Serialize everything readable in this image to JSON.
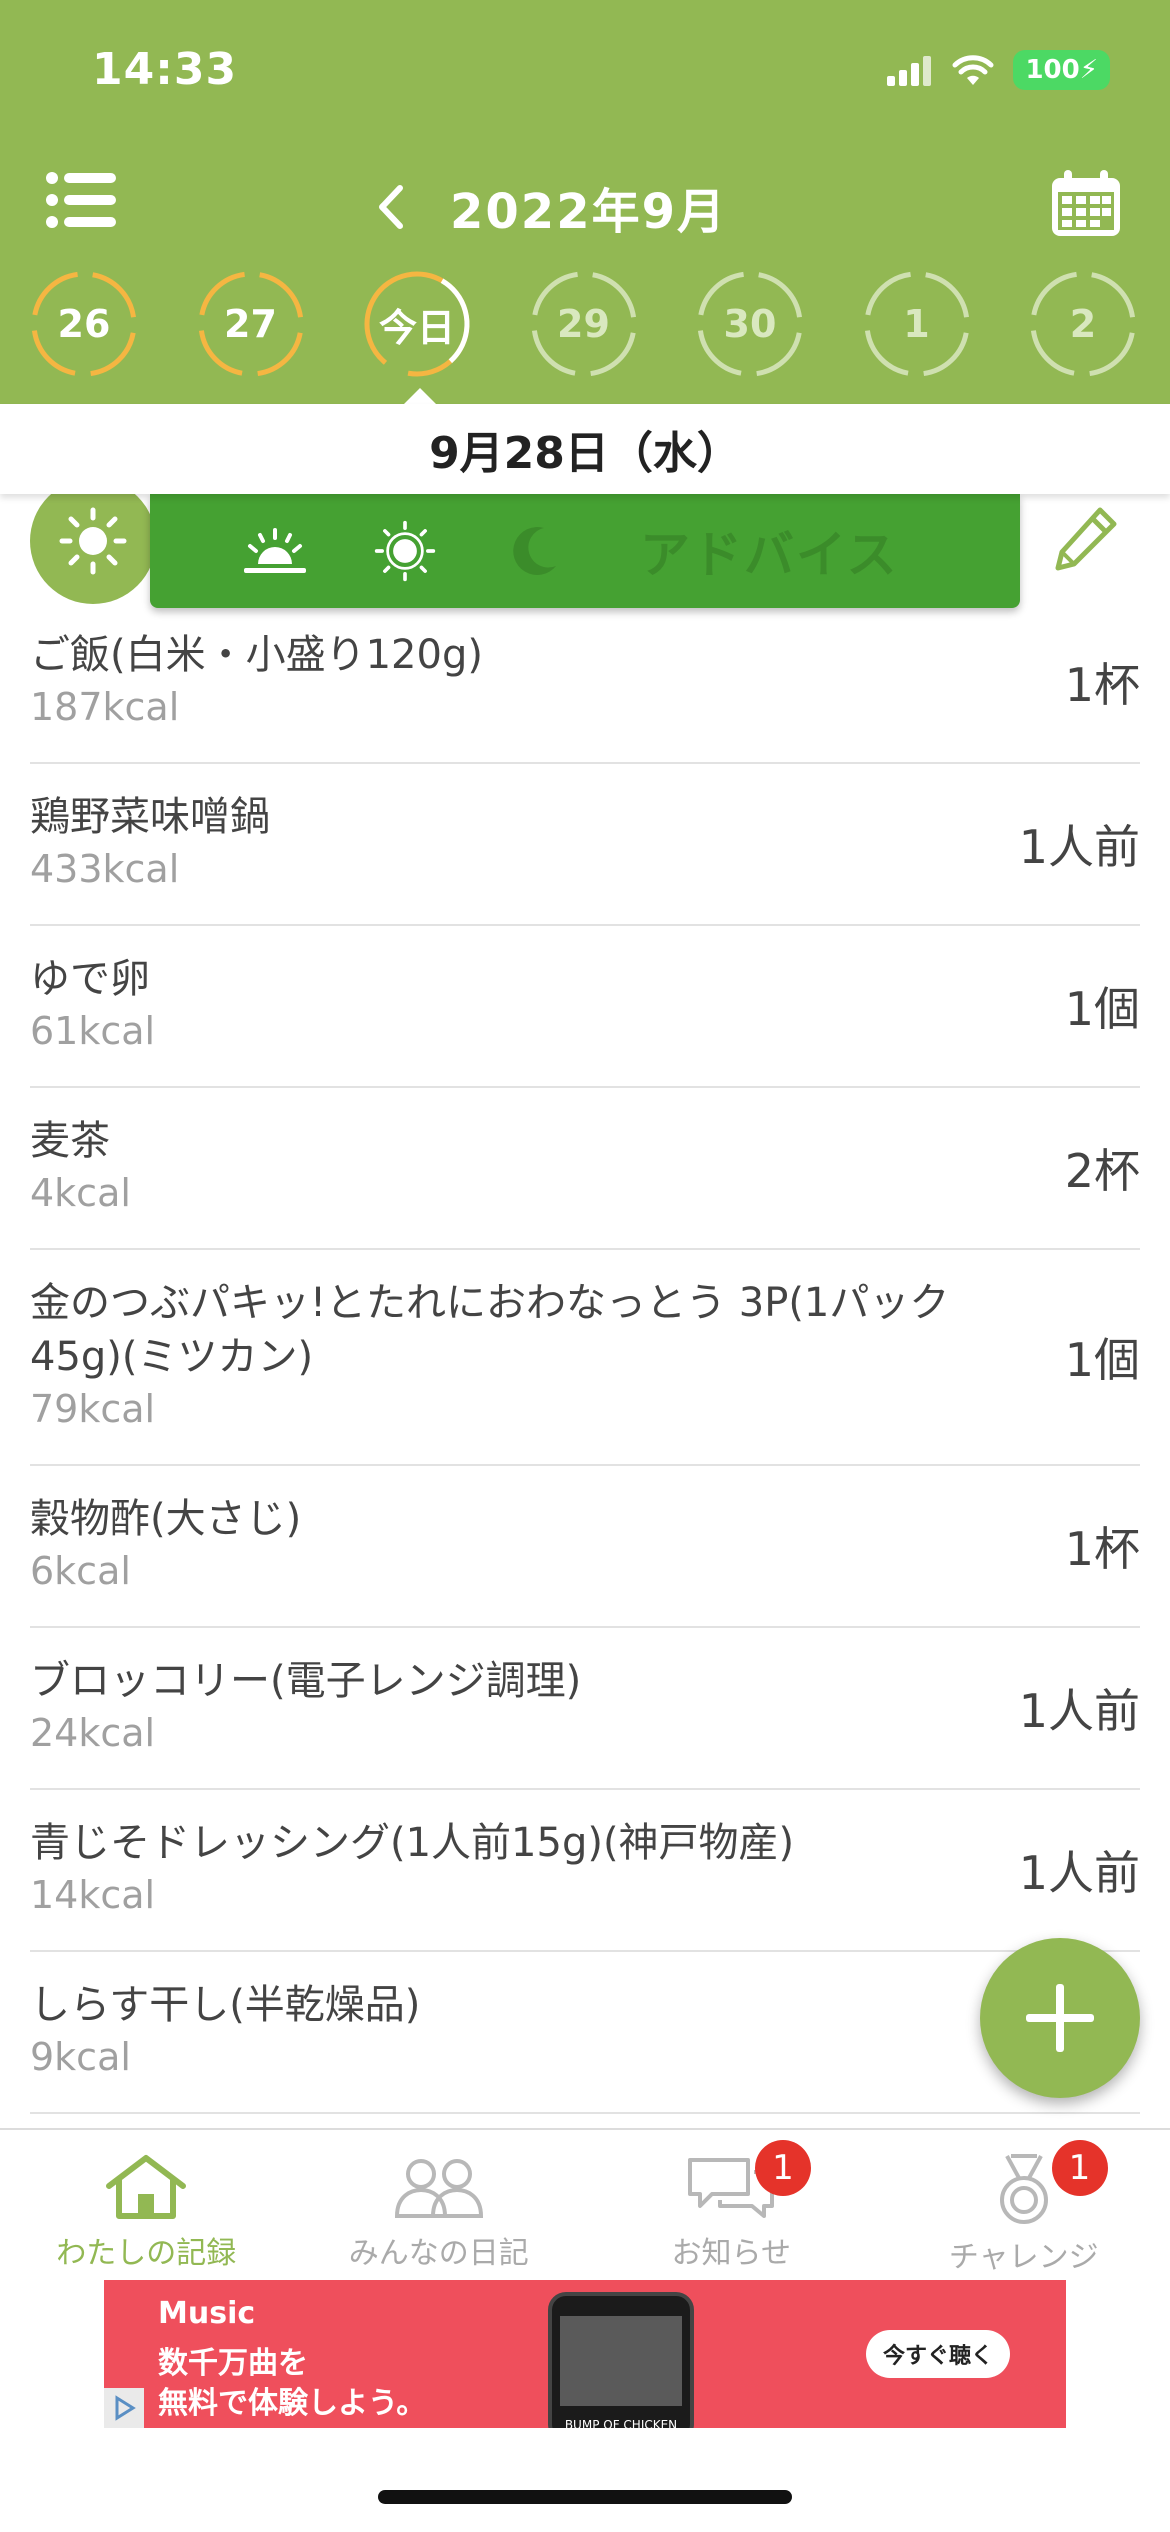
{
  "status_bar": {
    "time": "14:33",
    "battery": "100"
  },
  "header": {
    "month_title": "2022年9月",
    "days": [
      {
        "label": "26",
        "state": "past",
        "ring_color": "#f5b642"
      },
      {
        "label": "27",
        "state": "past",
        "ring_color": "#f5b642"
      },
      {
        "label": "今日",
        "state": "today",
        "ring_color": "#f5b642"
      },
      {
        "label": "29",
        "state": "future",
        "ring_color": "#cfe0b0"
      },
      {
        "label": "30",
        "state": "future",
        "ring_color": "#cfe0b0"
      },
      {
        "label": "1",
        "state": "future",
        "ring_color": "#cfe0b0"
      },
      {
        "label": "2",
        "state": "future",
        "ring_color": "#cfe0b0"
      }
    ]
  },
  "date_bar": {
    "label": "9月28日（水）"
  },
  "meal_tabs": {
    "icons": [
      "sunrise-icon",
      "sun-icon",
      "moon-icon"
    ],
    "advice_label": "アドバイス"
  },
  "foods": [
    {
      "name": "ご飯(白米・小盛り120g)",
      "kcal": "187kcal",
      "qty": "1杯"
    },
    {
      "name": "鶏野菜味噌鍋",
      "kcal": "433kcal",
      "qty": "1人前"
    },
    {
      "name": "ゆで卵",
      "kcal": "61kcal",
      "qty": "1個"
    },
    {
      "name": "麦茶",
      "kcal": "4kcal",
      "qty": "2杯"
    },
    {
      "name": "金のつぶパキッ!とたれにおわなっとう 3P(1パック45g)(ミツカン)",
      "kcal": "79kcal",
      "qty": "1個"
    },
    {
      "name": "穀物酢(大さじ)",
      "kcal": "6kcal",
      "qty": "1杯"
    },
    {
      "name": "ブロッコリー(電子レンジ調理)",
      "kcal": "24kcal",
      "qty": "1人前"
    },
    {
      "name": "青じそドレッシング(1人前15g)(神戸物産)",
      "kcal": "14kcal",
      "qty": "1人前"
    },
    {
      "name": "しらす干し(半乾燥品)",
      "kcal": "9kcal",
      "qty": ""
    }
  ],
  "bottom_nav": [
    {
      "label": "わたしの記録",
      "icon": "home-icon",
      "badge": ""
    },
    {
      "label": "みんなの日記",
      "icon": "people-icon",
      "badge": ""
    },
    {
      "label": "お知らせ",
      "icon": "chat-bubbles-icon",
      "badge": "1"
    },
    {
      "label": "チャレンジ",
      "icon": "medal-icon",
      "badge": "1"
    }
  ],
  "ad": {
    "brand": "Music",
    "copy_line1": "数千万曲を",
    "copy_line2": "無料で体験しよう。",
    "cta": "今すぐ聴く",
    "phone_caption": "BUMP OF CHICKEN"
  },
  "colors": {
    "header_green": "#92b853",
    "tab_green": "#45a132",
    "badge_red": "#e5332a",
    "ad_red": "#ef4f5c"
  }
}
